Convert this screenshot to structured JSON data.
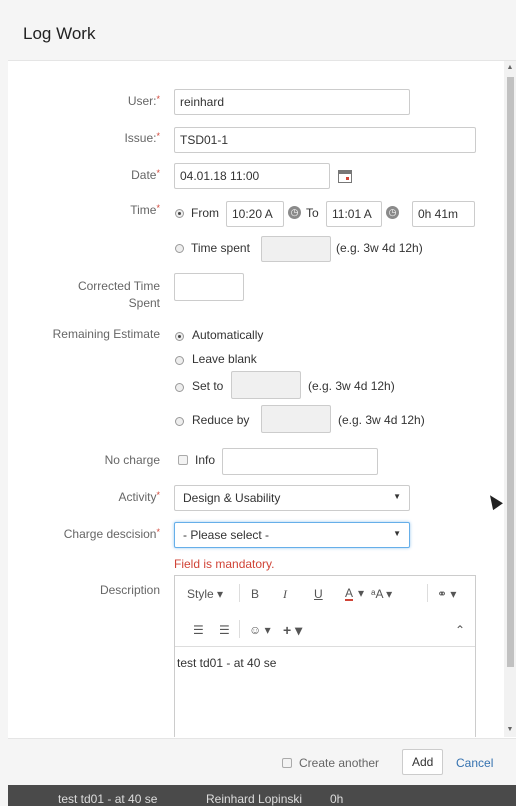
{
  "dialog": {
    "title": "Log Work"
  },
  "user": {
    "label": "User:",
    "value": "reinhard"
  },
  "issue": {
    "label": "Issue:",
    "value": "TSD01-1"
  },
  "date": {
    "label": "Date",
    "value": "04.01.18 11:00"
  },
  "time": {
    "label": "Time",
    "from_label": "From",
    "from_value": "10:20 A",
    "to_label": "To",
    "to_value": "11:01 A",
    "duration": "0h 41m",
    "spent_label": "Time spent",
    "spent_hint": "(e.g. 3w 4d 12h)"
  },
  "corrected": {
    "label_line1": "Corrected Time",
    "label_line2": "Spent",
    "value": ""
  },
  "remaining": {
    "label": "Remaining Estimate",
    "options": [
      "Automatically",
      "Leave blank",
      "Set to",
      "Reduce by"
    ],
    "hint": "(e.g. 3w 4d 12h)"
  },
  "no_charge": {
    "label": "No charge",
    "checkbox_label": "Info",
    "info_value": ""
  },
  "activity": {
    "label": "Activity",
    "value": "Design & Usability"
  },
  "charge": {
    "label": "Charge descision",
    "value": "- Please select -",
    "error": "Field is mandatory."
  },
  "description": {
    "label": "Description",
    "toolbar": {
      "style": "Style",
      "bold": "B",
      "italic": "I",
      "underline": "U",
      "color": "A",
      "more_text": "ᵃA",
      "link": "🔗"
    },
    "value": "test td01 - at 40 se"
  },
  "footer": {
    "create_another": "Create another",
    "add": "Add",
    "cancel": "Cancel"
  },
  "background": {
    "row_text": "test td01 - at 40 se",
    "row_user": "Reinhard Lopinski",
    "row_time": "0h"
  },
  "required_mark": "*",
  "colors": {
    "required": "#d04437",
    "link": "#3572b0",
    "focus": "#66afe9"
  }
}
